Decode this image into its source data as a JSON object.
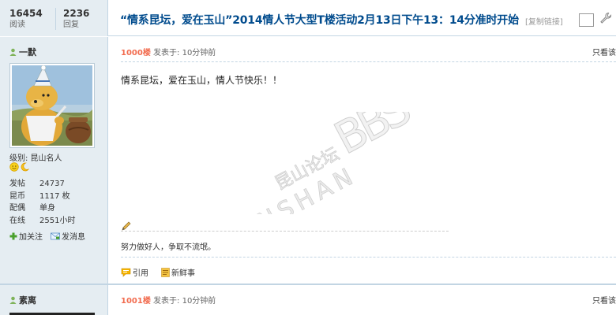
{
  "header": {
    "views_count": "16454",
    "views_label": "阅读",
    "replies_count": "2236",
    "replies_label": "回复",
    "title": "“情系昆坛，爱在玉山”2014情人节大型T楼活动2月13日下午13：14分准时开始",
    "copy_link": "[复制链接]"
  },
  "posts": [
    {
      "author": "一默",
      "level": "级别: 昆山名人",
      "info": [
        {
          "label": "发帖",
          "value": "24737"
        },
        {
          "label": "昆币",
          "value": "1117 枚"
        },
        {
          "label": "配偶",
          "value": "单身"
        },
        {
          "label": "在线",
          "value": "2551小时"
        }
      ],
      "add_follow": "加关注",
      "send_message": "发消息",
      "floor": "1000楼",
      "posted": "发表于: 10分钟前",
      "view_only": "只看该",
      "content": "情系昆坛，爱在玉山，情人节快乐！！",
      "signature": "努力做好人，争取不流氓。",
      "quote_label": "引用",
      "news_label": "新鲜事"
    },
    {
      "author": "素离",
      "floor": "1001楼",
      "posted": "发表于: 10分钟前",
      "view_only": "只看该"
    }
  ],
  "watermark": {
    "cn": "昆山论坛",
    "en": "KUNSHAN",
    "bbs": "BBS"
  },
  "colors": {
    "sidebar_bg": "#e5edf2",
    "border": "#c2d5e3",
    "title": "#004b8d",
    "floor": "#f26c4f"
  }
}
